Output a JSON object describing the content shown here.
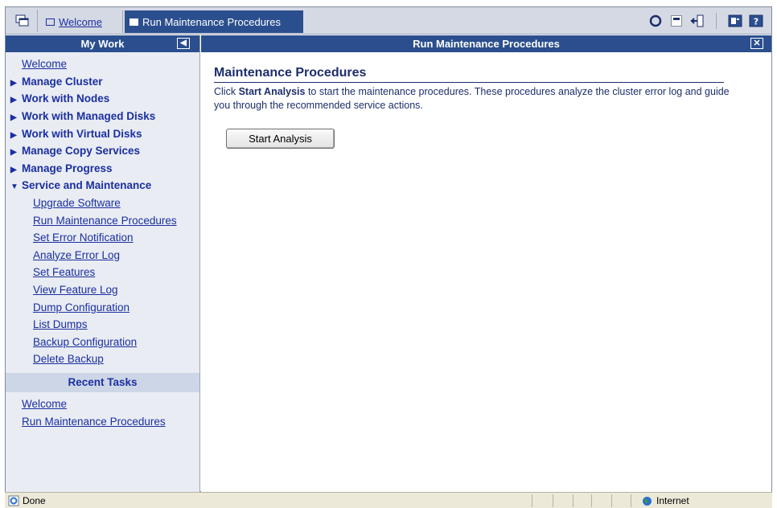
{
  "topbar": {
    "tabs": [
      {
        "label": "Welcome"
      },
      {
        "label": "Run Maintenance Procedures"
      }
    ],
    "icons": [
      "refresh-icon",
      "minimize-icon",
      "exit-icon",
      "help-panel-icon",
      "help-icon"
    ]
  },
  "leftnav": {
    "title": "My Work",
    "items": [
      {
        "label": "Welcome"
      },
      {
        "label": "Manage Cluster"
      },
      {
        "label": "Work with Nodes"
      },
      {
        "label": "Work with Managed Disks"
      },
      {
        "label": "Work with Virtual Disks"
      },
      {
        "label": "Manage Copy Services"
      },
      {
        "label": "Manage Progress"
      },
      {
        "label": "Service and Maintenance"
      }
    ],
    "subitems": [
      {
        "label": "Upgrade Software"
      },
      {
        "label": "Run Maintenance Procedures"
      },
      {
        "label": "Set Error Notification"
      },
      {
        "label": "Analyze Error Log"
      },
      {
        "label": "Set Features"
      },
      {
        "label": "View Feature Log"
      },
      {
        "label": "Dump Configuration"
      },
      {
        "label": "List Dumps"
      },
      {
        "label": "Backup Configuration"
      },
      {
        "label": "Delete Backup"
      }
    ],
    "recent_title": "Recent Tasks",
    "recent": [
      {
        "label": "Welcome"
      },
      {
        "label": "Run Maintenance Procedures"
      }
    ]
  },
  "main": {
    "header": "Run Maintenance Procedures",
    "section_title": "Maintenance Procedures",
    "desc_before": "Click ",
    "desc_bold": "Start Analysis",
    "desc_after": " to start the maintenance procedures. These procedures analyze the cluster error log and guide you through the recommended service actions.",
    "start_button": "Start Analysis"
  },
  "status": {
    "text": "Done",
    "zone": "Internet"
  },
  "colors": {
    "header_bg": "#2b4f8e",
    "link": "#1a2fa0",
    "nav_bg": "#e9ecf3"
  }
}
